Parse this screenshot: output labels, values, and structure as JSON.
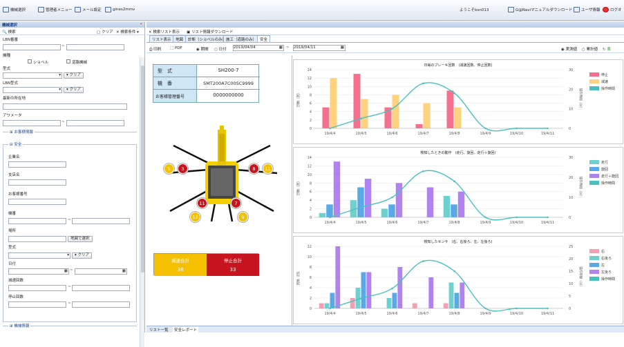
{
  "topbar": {
    "left": [
      "機械選択",
      "管理者メニュー",
      "メール設定",
      "gines2mmv"
    ],
    "welcome": "ようこそbsn013",
    "manual": "G@Naviマニュアルダウンロード",
    "userinfo": "ユーザ情報",
    "logout": "ログオ"
  },
  "left": {
    "title": "機械選択",
    "search": "検索",
    "clear": "クリア",
    "cond": "検索条件",
    "l_lbn": "LBN番番",
    "l_kikai": "機種",
    "opt1": "ショベル",
    "opt2": "道路機械",
    "l_katashiki": "型式",
    "clear_btn": "クリア",
    "l_lbnkata": "LBN型式",
    "l_place": "最新の所在地",
    "l_meter": "アワメータ",
    "grp_customer": "お客様情報",
    "grp_safety": "安全",
    "l_company": "企業名",
    "l_branch": "支店名",
    "l_custno": "お客様番号",
    "l_kiban": "機番",
    "l_basho": "場所",
    "map_btn": "地図で選択",
    "l_kata2": "型式",
    "l_date": "日付",
    "l_gensoku": "減速回数",
    "l_teishi": "停止回数",
    "grp_machine": "機械情報"
  },
  "right": {
    "tabs_top": [
      "検索リスト表示",
      "リスト情報ダウンロード"
    ],
    "tabs": [
      "リスト表示",
      "地図",
      "診断（ショベルのみ）",
      "施工（道路のみ）",
      "安全"
    ],
    "print": "印刷",
    "pdf": "PDF",
    "period": "期間",
    "date": "日付",
    "from": "2019/04/04",
    "to": "2019/04/11",
    "actual": "実測値",
    "cum": "累計値",
    "disp": "表",
    "bottom_tabs": [
      "リスト一覧",
      "安全レポート"
    ]
  },
  "machine": {
    "h_kata": "型　式",
    "v_kata": "SH200-7",
    "h_kiban": "機　番",
    "v_kiban": "SMT200A7C00SC9999",
    "h_cust": "お客様管理番号",
    "v_cust": "0000000000"
  },
  "badges": {
    "l_y": "5",
    "l_r": "3",
    "r_r": "8",
    "r_y": "11",
    "bl_r": "11",
    "bl_y": "12",
    "br_r": "7",
    "br_y": "9"
  },
  "totals": {
    "gensoku_label": "減速合計",
    "teishi_label": "停止合計",
    "gensoku": "38",
    "teishi": "33"
  },
  "chart_data": [
    {
      "type": "bar",
      "title": "日毎のブレーキ回数　(減速回数、停止回数)",
      "categories": [
        "19/4/4",
        "19/4/5",
        "19/4/6",
        "19/4/7",
        "19/4/8",
        "19/4/9",
        "19/4/10",
        "19/4/11"
      ],
      "ylim": [
        0,
        14
      ],
      "y2lim": [
        0,
        30
      ],
      "ylabel": "回数（回）",
      "y2label": "操作時間（分）",
      "series": [
        {
          "name": "停止",
          "color": "#f4708c",
          "values": [
            5,
            13,
            5,
            1,
            9,
            0,
            0,
            0
          ]
        },
        {
          "name": "減速",
          "color": "#ffd27f",
          "values": [
            12,
            7,
            8,
            6,
            5,
            0,
            0,
            0
          ]
        }
      ],
      "line": {
        "name": "操作時間",
        "color": "#4bc0c0",
        "values": [
          0,
          5,
          10,
          23,
          18,
          0,
          0,
          0
        ]
      }
    },
    {
      "type": "bar",
      "title": "検知したときの動作　(走行、旋回、走行＋旋回)",
      "categories": [
        "19/4/4",
        "19/4/5",
        "19/4/6",
        "19/4/7",
        "19/4/8",
        "19/4/9",
        "19/4/10",
        "19/4/11"
      ],
      "ylim": [
        0,
        14
      ],
      "y2lim": [
        0,
        30
      ],
      "ylabel": "回数（回）",
      "y2label": "操作時間（分）",
      "series": [
        {
          "name": "走行",
          "color": "#6fd0d0",
          "values": [
            1,
            4,
            2,
            0,
            5,
            0,
            0,
            0
          ]
        },
        {
          "name": "旋回",
          "color": "#5aa9e6",
          "values": [
            3,
            7,
            3,
            0,
            3,
            0,
            0,
            0
          ]
        },
        {
          "name": "走行＋旋回",
          "color": "#b183f0",
          "values": [
            13,
            9,
            8,
            7,
            6,
            0,
            0,
            0
          ]
        }
      ],
      "line": {
        "name": "操作時間",
        "color": "#4bc0c0",
        "values": [
          0,
          5,
          10,
          23,
          18,
          0,
          0,
          0
        ]
      }
    },
    {
      "type": "bar",
      "title": "検知したセンサ　(右、右後ろ、左、左後ろ)",
      "categories": [
        "19/4/4",
        "19/4/5",
        "19/4/6",
        "19/4/7",
        "19/4/8",
        "19/4/9",
        "19/4/10",
        "19/4/11"
      ],
      "ylim": [
        0,
        12
      ],
      "y2lim": [
        0,
        25
      ],
      "ylabel": "回数（回）",
      "y2label": "操作時間（分）",
      "series": [
        {
          "name": "右",
          "color": "#f4a0b4",
          "values": [
            1,
            2,
            0,
            1,
            1,
            0,
            0,
            0
          ]
        },
        {
          "name": "右後ろ",
          "color": "#6fd0d0",
          "values": [
            1,
            4,
            2,
            0,
            5,
            0,
            0,
            0
          ]
        },
        {
          "name": "左",
          "color": "#5aa9e6",
          "values": [
            3,
            7,
            3,
            0,
            3,
            0,
            0,
            0
          ]
        },
        {
          "name": "左後ろ",
          "color": "#b183f0",
          "values": [
            12,
            7,
            8,
            6,
            5,
            0,
            0,
            0
          ]
        }
      ],
      "line": {
        "name": "操作時間",
        "color": "#4bc0c0",
        "values": [
          0,
          4,
          8,
          19,
          15,
          0,
          0,
          0
        ]
      }
    }
  ]
}
